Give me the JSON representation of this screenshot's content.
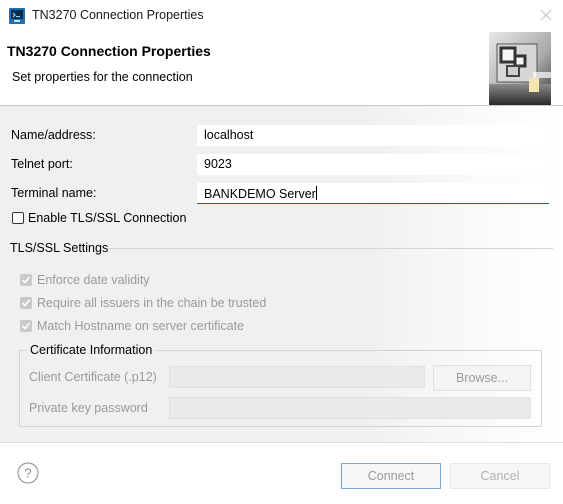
{
  "window": {
    "title": "TN3270 Connection Properties"
  },
  "banner": {
    "title": "TN3270 Connection Properties",
    "subtitle": "Set properties for the connection"
  },
  "form": {
    "name_label": "Name/address:",
    "name_value": "localhost",
    "port_label": "Telnet port:",
    "port_value": "9023",
    "terminal_label": "Terminal name:",
    "terminal_value": "BANKDEMO Server",
    "tls_checkbox_label": "Enable TLS/SSL Connection",
    "tls_enabled": false
  },
  "tls_settings": {
    "group_label": "TLS/SSL Settings",
    "options": [
      {
        "label": "Enforce date validity",
        "checked": true,
        "enabled": false
      },
      {
        "label": "Require all issuers in the chain be trusted",
        "checked": true,
        "enabled": false
      },
      {
        "label": "Match Hostname on server certificate",
        "checked": true,
        "enabled": false
      }
    ],
    "certificate": {
      "group_label": "Certificate Information",
      "client_cert_label": "Client Certificate (.p12)",
      "client_cert_value": "",
      "browse_label": "Browse...",
      "key_password_label": "Private key password",
      "key_password_value": ""
    }
  },
  "footer": {
    "connect_label": "Connect",
    "cancel_label": "Cancel"
  },
  "icons": {
    "app": "terminal-app-icon",
    "close": "close-icon",
    "banner": "connection-wizard-icon",
    "help": "help-icon"
  },
  "colors": {
    "focus_underline": "#1565c0",
    "connect_border": "#7fa7d6",
    "disabled_text": "#9a9a9a"
  }
}
